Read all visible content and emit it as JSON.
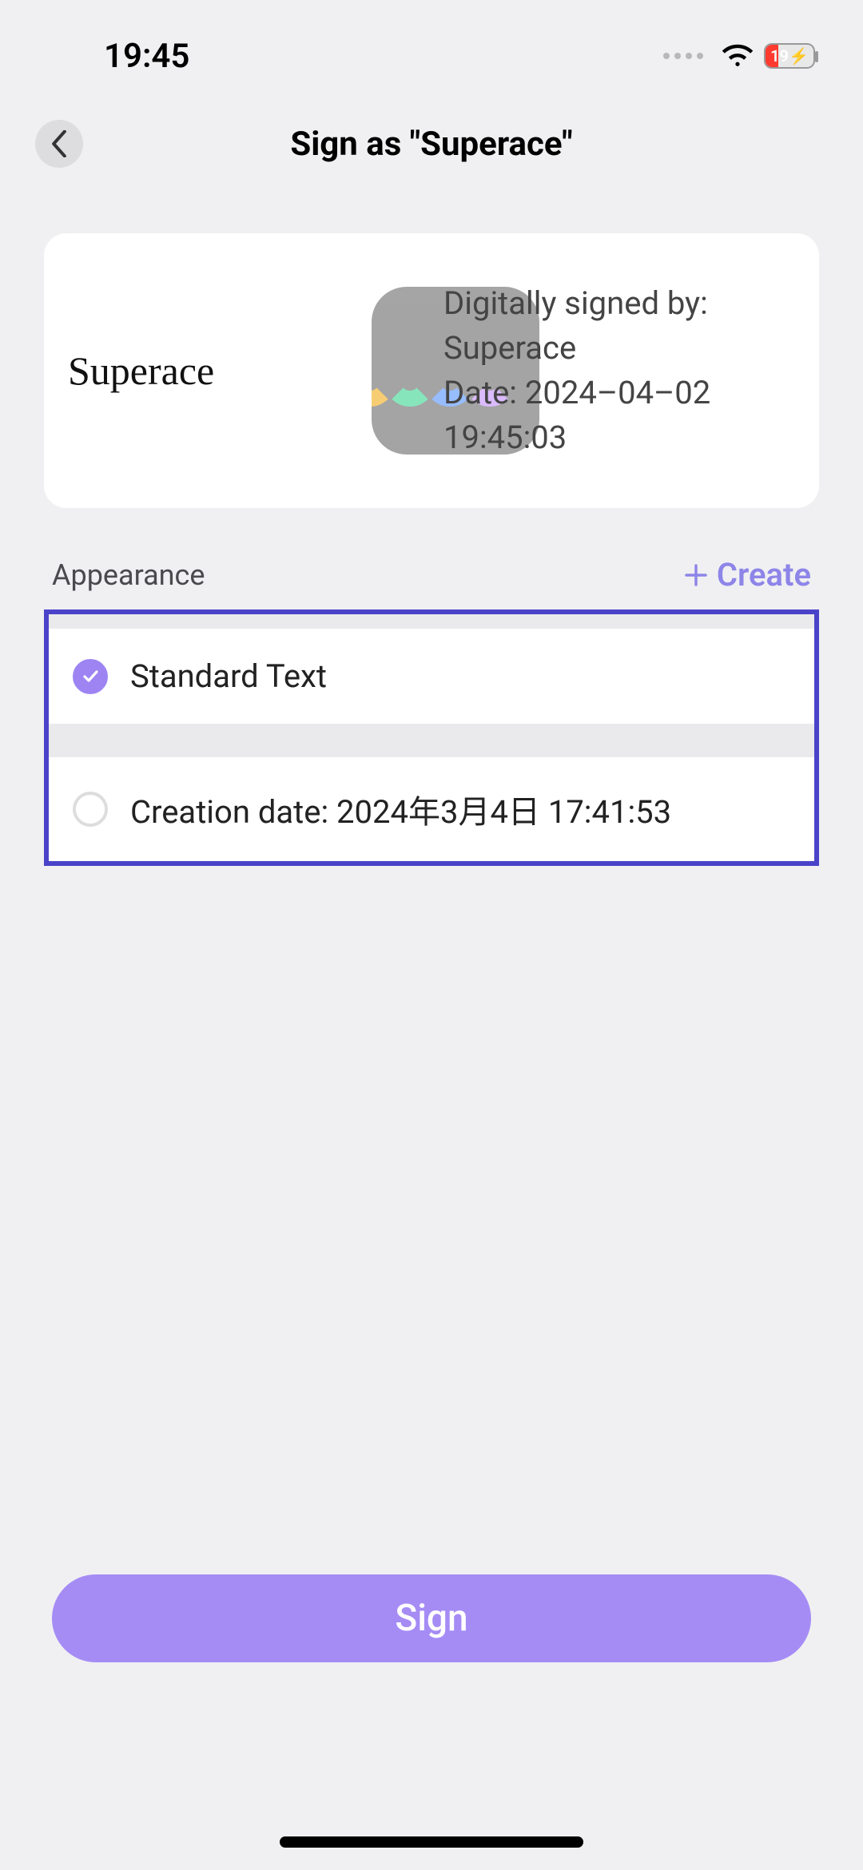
{
  "status": {
    "time": "19:45",
    "battery": "19"
  },
  "header": {
    "title": "Sign as \"Superace\""
  },
  "preview": {
    "signer_name": "Superace",
    "line1": "Digitally signed by:",
    "line2": "Superace",
    "line3": "Date: 2024–04–02",
    "line4": "19:45:03"
  },
  "appearance": {
    "label": "Appearance",
    "create_label": "Create",
    "options": [
      {
        "label": "Standard Text",
        "selected": true
      },
      {
        "label": "Creation date: 2024年3月4日 17:41:53",
        "selected": false
      }
    ]
  },
  "actions": {
    "sign_label": "Sign"
  }
}
